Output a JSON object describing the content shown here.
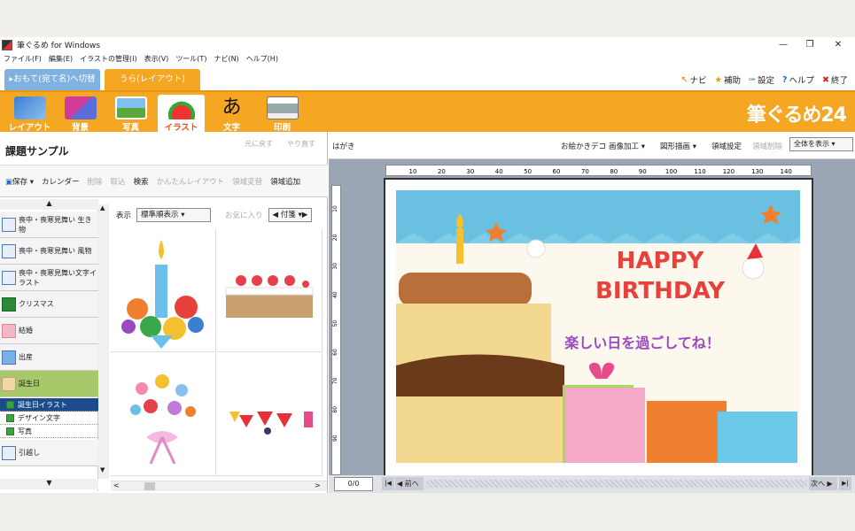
{
  "window": {
    "title": "筆ぐるめ for Windows"
  },
  "menu": [
    "ファイル(F)",
    "編集(E)",
    "イラストの管理(I)",
    "表示(V)",
    "ツール(T)",
    "ナビ(N)",
    "ヘルプ(H)"
  ],
  "view_tabs": {
    "front": "▸おもて(宛て名)へ切替",
    "back": "うら(レイアウト)"
  },
  "top_links": {
    "navi": "ナビ",
    "assist": "補助",
    "settings": "設定",
    "help": "ヘルプ",
    "exit": "終了"
  },
  "tools": [
    {
      "label": "レイアウト",
      "icon": "layout-icon"
    },
    {
      "label": "背景",
      "icon": "background-icon"
    },
    {
      "label": "写真",
      "icon": "photo-icon"
    },
    {
      "label": "イラスト",
      "icon": "illustration-icon"
    },
    {
      "label": "文字",
      "icon": "text-icon"
    },
    {
      "label": "印刷",
      "icon": "printer-icon"
    }
  ],
  "brand": "筆ぐるめ24",
  "left": {
    "title": "課題サンプル",
    "back": "元に戻す",
    "redo": "やり直す",
    "toolbar": [
      "保存",
      "カレンダー",
      "削除",
      "取込",
      "検索",
      "かんたんレイアウト",
      "領域変替",
      "領域追加"
    ],
    "categories": [
      "喪中・喪寒見舞い 生き物",
      "喪中・喪寒見舞い 風物",
      "喪中・喪寒見舞い文字イラスト",
      "クリスマス",
      "結婚",
      "出産",
      "誕生日",
      "引越し"
    ],
    "subcategories": [
      "誕生日イラスト",
      "デザイン文字",
      "写真"
    ],
    "display_label": "表示",
    "sort": "標準順表示",
    "favorite": "お気に入り",
    "tag": "付箋"
  },
  "right": {
    "label": "はがき",
    "toolbar": [
      "お絵かきデコ",
      "画像加工",
      "図形描画",
      "領域設定",
      "領域削除"
    ],
    "zoom": "全体を表示",
    "ruler_h": [
      "10",
      "20",
      "30",
      "40",
      "50",
      "60",
      "70",
      "80",
      "90",
      "100",
      "110",
      "120",
      "130",
      "140"
    ],
    "ruler_v": [
      "10",
      "20",
      "30",
      "40",
      "50",
      "60",
      "70",
      "80",
      "90"
    ],
    "page_counter": "0/0",
    "prev": "前へ",
    "next": "次へ"
  },
  "card": {
    "line1": "HAPPY",
    "line2": "BIRTHDAY",
    "message": "楽しい日を過ごしてね！"
  },
  "colors": {
    "orange": "#f5a623",
    "blue_tab": "#7fb2e0",
    "selected": "#1b4b8a",
    "green": "#a8c96a"
  }
}
